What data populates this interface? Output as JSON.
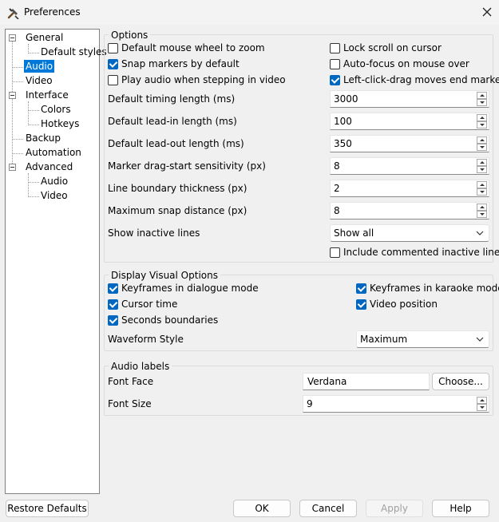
{
  "window": {
    "title": "Preferences"
  },
  "tree": {
    "items": [
      {
        "label": "General"
      },
      {
        "label": "Default styles"
      },
      {
        "label": "Audio"
      },
      {
        "label": "Video"
      },
      {
        "label": "Interface"
      },
      {
        "label": "Colors"
      },
      {
        "label": "Hotkeys"
      },
      {
        "label": "Backup"
      },
      {
        "label": "Automation"
      },
      {
        "label": "Advanced"
      },
      {
        "label": "Audio"
      },
      {
        "label": "Video"
      }
    ],
    "selected": "Audio",
    "selection_color": "#0078d7"
  },
  "options": {
    "title": "Options",
    "checks": [
      {
        "label": "Default mouse wheel to zoom",
        "checked": false
      },
      {
        "label": "Lock scroll on cursor",
        "checked": false
      },
      {
        "label": "Snap markers by default",
        "checked": true
      },
      {
        "label": "Auto-focus on mouse over",
        "checked": false
      },
      {
        "label": "Play audio when stepping in video",
        "checked": false
      },
      {
        "label": "Left-click-drag moves end marker",
        "checked": true
      }
    ],
    "fields": [
      {
        "label": "Default timing length (ms)",
        "value": "3000"
      },
      {
        "label": "Default lead-in length (ms)",
        "value": "100"
      },
      {
        "label": "Default lead-out length (ms)",
        "value": "350"
      },
      {
        "label": "Marker drag-start sensitivity (px)",
        "value": "8"
      },
      {
        "label": "Line boundary thickness (px)",
        "value": "2"
      },
      {
        "label": "Maximum snap distance (px)",
        "value": "8"
      }
    ],
    "inactive": {
      "label": "Show inactive lines",
      "value": "Show all"
    },
    "include_commented": {
      "label": "Include commented inactive lines",
      "checked": false
    }
  },
  "display": {
    "title": "Display Visual Options",
    "checks": [
      {
        "label": "Keyframes in dialogue mode",
        "checked": true
      },
      {
        "label": "Keyframes in karaoke mode",
        "checked": true
      },
      {
        "label": "Cursor time",
        "checked": true
      },
      {
        "label": "Video position",
        "checked": true
      },
      {
        "label": "Seconds boundaries",
        "checked": true
      }
    ],
    "waveform": {
      "label": "Waveform Style",
      "value": "Maximum"
    }
  },
  "audio_labels": {
    "title": "Audio labels",
    "font_face": {
      "label": "Font Face",
      "value": "Verdana",
      "button": "Choose..."
    },
    "font_size": {
      "label": "Font Size",
      "value": "9"
    }
  },
  "footer": {
    "restore": "Restore Defaults",
    "ok": "OK",
    "cancel": "Cancel",
    "apply": "Apply",
    "help": "Help"
  },
  "accent_color": "#0067c0"
}
